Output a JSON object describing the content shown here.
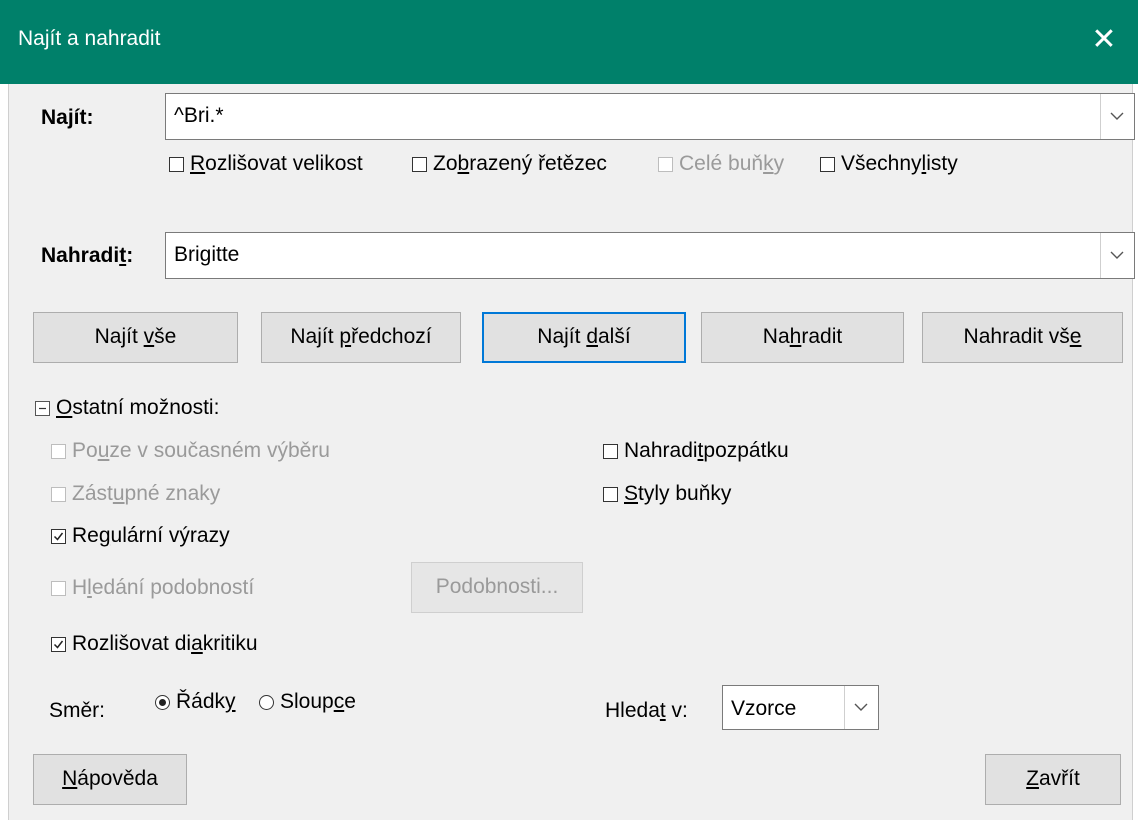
{
  "window": {
    "title": "Najít a nahradit",
    "close_icon": "close-icon"
  },
  "find": {
    "label_pre": "Najít:",
    "value": "^Bri.*",
    "options": [
      {
        "pre": "",
        "ul": "R",
        "post": "ozlišovat velikost",
        "checked": false,
        "disabled": false
      },
      {
        "pre": "Zo",
        "ul": "b",
        "post": "razený řetězec",
        "checked": false,
        "disabled": false
      },
      {
        "pre": "Celé buň",
        "ul": "k",
        "post": "y",
        "checked": false,
        "disabled": true
      },
      {
        "pre": "Všechny ",
        "ul": "l",
        "post": "isty",
        "checked": false,
        "disabled": false
      }
    ]
  },
  "replace": {
    "label_pre": "Nahradi",
    "label_ul": "t",
    "label_post": ":",
    "value": "Brigitte"
  },
  "buttons": {
    "find_all": {
      "pre": "Najít ",
      "ul": "v",
      "post": "še"
    },
    "find_prev": {
      "pre": "Najít ",
      "ul": "p",
      "post": "ředchozí"
    },
    "find_next": {
      "pre": "Najít ",
      "ul": "d",
      "post": "alší"
    },
    "replace": {
      "pre": "Na",
      "ul": "h",
      "post": "radit"
    },
    "replace_all": {
      "pre": "Nahradit vš",
      "ul": "e",
      "post": ""
    }
  },
  "other": {
    "toggle_pre": "",
    "toggle_ul": "O",
    "toggle_post": "statní možnosti:",
    "current_selection": {
      "pre": "Po",
      "ul": "u",
      "post": "ze v současném výběru",
      "checked": false,
      "disabled": true
    },
    "wildcards": {
      "pre": "Zást",
      "ul": "u",
      "post": "pné znaky",
      "checked": false,
      "disabled": true
    },
    "regex": {
      "pre": "Re",
      "ul": "g",
      "post": "ulární výrazy",
      "checked": true,
      "disabled": false
    },
    "similarity": {
      "pre": "H",
      "ul": "l",
      "post": "edání podobností",
      "checked": false,
      "disabled": true
    },
    "similarity_button": "Podobnosti...",
    "diacritics": {
      "pre": "Rozlišovat di",
      "ul": "a",
      "post": "kritiku",
      "checked": true,
      "disabled": false
    },
    "backwards": {
      "pre": "Nahradi",
      "ul": "t",
      "post": " pozpátku",
      "checked": false,
      "disabled": false
    },
    "cell_styles": {
      "pre": "",
      "ul": "S",
      "post": "tyly buňky",
      "checked": false,
      "disabled": false
    },
    "direction_label": "Směr:",
    "rows": {
      "pre": "Řádk",
      "ul": "y",
      "post": "",
      "selected": true
    },
    "columns": {
      "pre": "Sloup",
      "ul": "c",
      "post": "e",
      "selected": false
    },
    "search_in_pre": "Hleda",
    "search_in_ul": "t",
    "search_in_post": " v:",
    "search_in_value": "Vzorce"
  },
  "footer": {
    "help": {
      "pre": "",
      "ul": "N",
      "post": "ápověda"
    },
    "close": {
      "pre": "",
      "ul": "Z",
      "post": "avřít"
    }
  },
  "colors": {
    "titlebar": "#00806a",
    "focus": "#0078d7",
    "dialog_bg": "#f0f0f0"
  }
}
